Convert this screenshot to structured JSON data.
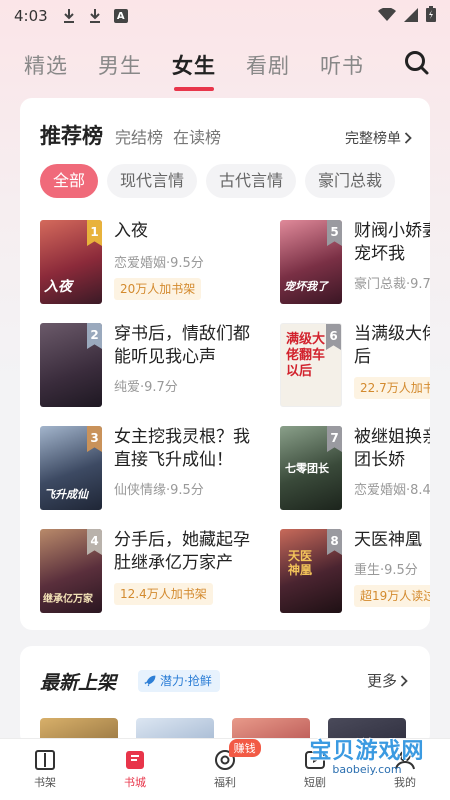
{
  "status_bar": {
    "time": "4:03",
    "a_icon": "A"
  },
  "top_tabs": [
    "精选",
    "男生",
    "女生",
    "看剧",
    "听书"
  ],
  "ranking": {
    "title": "推荐榜",
    "sub_tabs": [
      "完结榜",
      "在读榜"
    ],
    "more": "完整榜单",
    "filters": [
      "全部",
      "现代言情",
      "古代言情",
      "豪门总裁"
    ],
    "books": [
      {
        "rank": "1",
        "title": "入夜",
        "meta": "恋爱婚姻·9.5分",
        "badge": "20万人加书架",
        "cover_text": "入夜",
        "cover_color": "#8b2a3a"
      },
      {
        "rank": "2",
        "title": "穿书后，情敌们都能听见我心声",
        "meta": "纯爱·9.7分",
        "badge": "",
        "cover_text": "",
        "cover_color": "#4a3a4e"
      },
      {
        "rank": "3",
        "title": "女主挖我灵根？我直接飞升成仙！",
        "meta": "仙侠情缘·9.5分",
        "badge": "",
        "cover_text": "飞升成仙",
        "cover_color": "#3d4a63"
      },
      {
        "rank": "4",
        "title": "分手后，她藏起孕肚继承亿万家产",
        "meta": "",
        "badge": "12.4万人加书架",
        "cover_text": "继承亿万家",
        "cover_color": "#5a2f3c"
      },
      {
        "rank": "5",
        "title": "财阀小娇妻，你要宠坏我",
        "meta": "豪门总裁·9.7",
        "badge": "",
        "cover_text": "宠坏我了",
        "cover_color": "#7a3045"
      },
      {
        "rank": "6",
        "title": "当满级大佬翻车以后",
        "meta": "",
        "badge": "22.7万人加书",
        "cover_text": "满级大佬翻车以后",
        "cover_color": "#f4f0e8"
      },
      {
        "rank": "7",
        "title": "被继姐换亲，七零团长娇",
        "meta": "恋爱婚姻·8.4",
        "badge": "",
        "cover_text": "七零团长",
        "cover_color": "#3a4a3a"
      },
      {
        "rank": "8",
        "title": "天医神凰",
        "meta": "重生·9.5分",
        "badge": "超19万人读过",
        "cover_text": "天医神凰",
        "cover_color": "#4a2430"
      }
    ]
  },
  "latest": {
    "title": "最新上架",
    "tag": "潜力·抢鲜",
    "more": "更多"
  },
  "bottom_nav": [
    {
      "label": "书架",
      "icon": "book-icon"
    },
    {
      "label": "书城",
      "icon": "bookstore-icon"
    },
    {
      "label": "福利",
      "icon": "gift-icon",
      "badge": "赚钱"
    },
    {
      "label": "短剧",
      "icon": "video-icon"
    },
    {
      "label": "我的",
      "icon": "user-icon"
    }
  ],
  "watermark": {
    "big": "宝贝游戏网",
    "small": "baobeiy.com"
  },
  "colors": {
    "accent": "#e8354a",
    "chip_active": "#f06a7a",
    "badge_bg": "#fdf3e2",
    "badge_text": "#d38a2e"
  }
}
